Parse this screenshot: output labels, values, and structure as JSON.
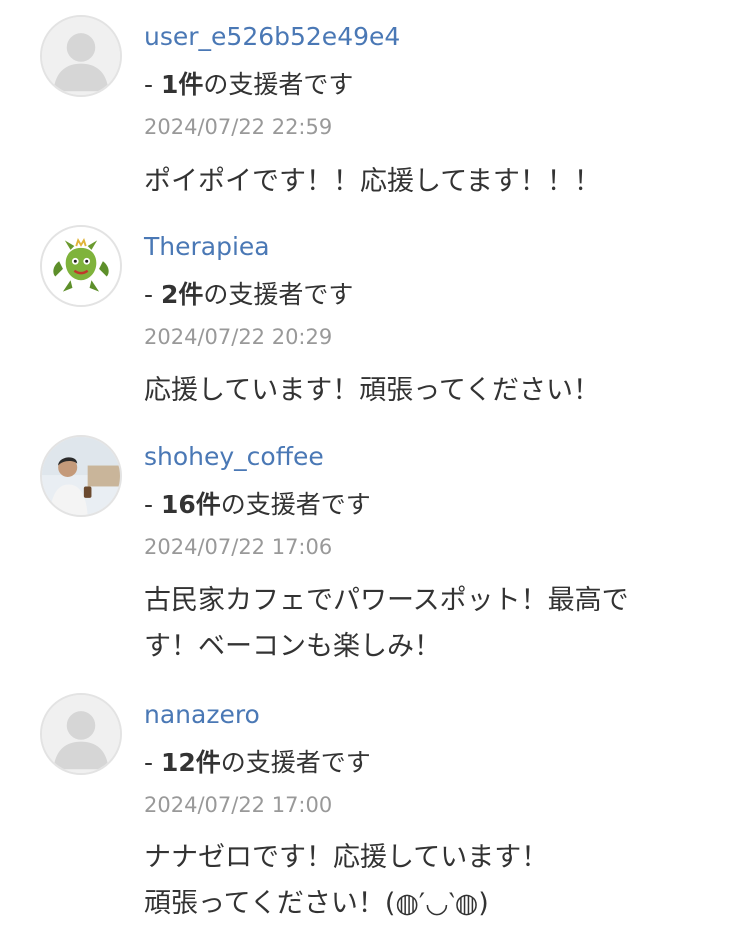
{
  "comments": [
    {
      "username": "user_e526b52e49e4",
      "supporter_prefix": "- ",
      "supporter_count": "1件",
      "supporter_suffix": "の支援者です",
      "date": "2024/07/22 22:59",
      "message_lines": [
        "ポイポイです！！応援してます！！！"
      ],
      "avatar": "default-user-icon"
    },
    {
      "username": "Therapiea",
      "supporter_prefix": "- ",
      "supporter_count": "2件",
      "supporter_suffix": "の支援者です",
      "date": "2024/07/22 20:29",
      "message_lines": [
        "応援しています！頑張ってください！"
      ],
      "avatar": "dragon-icon"
    },
    {
      "username": "shohey_coffee",
      "supporter_prefix": "- ",
      "supporter_count": "16件",
      "supporter_suffix": "の支援者です",
      "date": "2024/07/22 17:06",
      "message_lines": [
        "古民家カフェでパワースポット！最高で",
        "す！ベーコンも楽しみ！"
      ],
      "avatar": "person-photo-icon"
    },
    {
      "username": "nanazero",
      "supporter_prefix": "- ",
      "supporter_count": "12件",
      "supporter_suffix": "の支援者です",
      "date": "2024/07/22 17:00",
      "message_lines": [
        "ナナゼロです！応援しています！",
        "頑張ってください！(◍′◡‵◍)"
      ],
      "avatar": "default-user-icon"
    }
  ]
}
